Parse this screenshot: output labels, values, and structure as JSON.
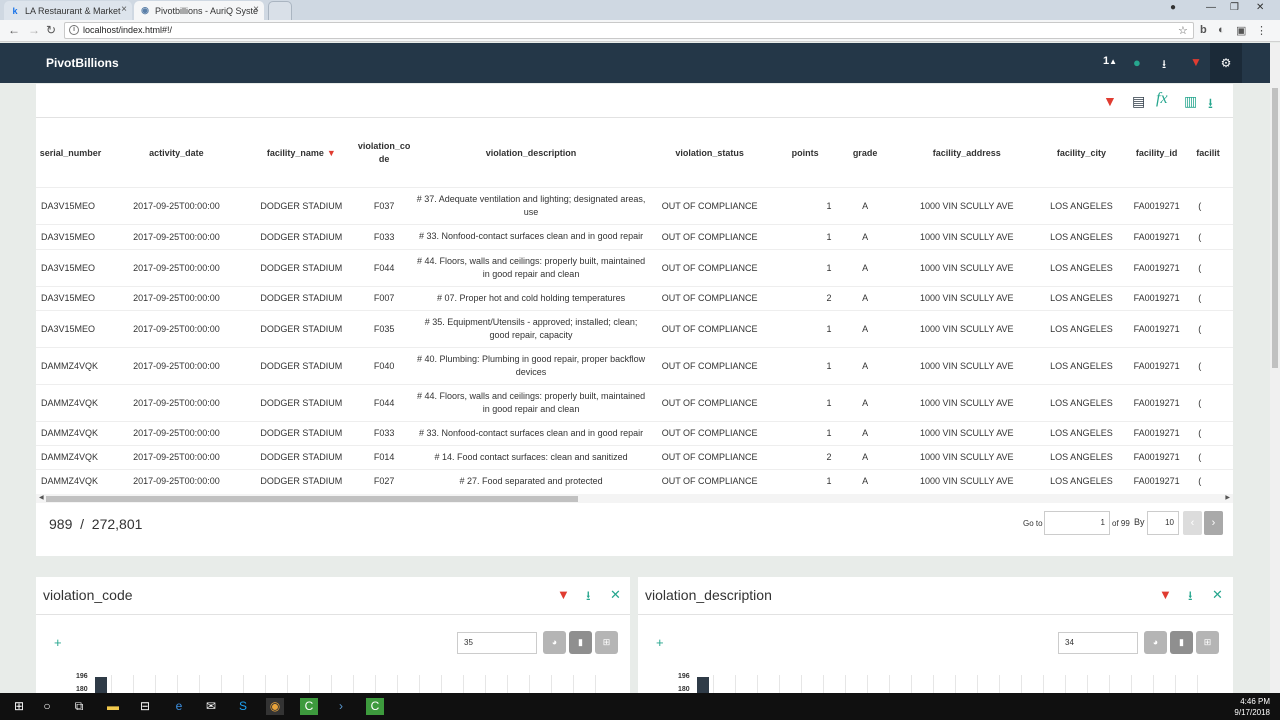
{
  "browser": {
    "tabs": [
      {
        "label": "LA Restaurant & Market",
        "favicon": "k"
      },
      {
        "label": "Pivotbillions - AuriQ Syste",
        "favicon": "globe"
      }
    ],
    "url": "localhost/index.html#!/"
  },
  "app": {
    "brand": "PivotBillions",
    "header_user_count": "1"
  },
  "table": {
    "columns": [
      "serial_number",
      "activity_date",
      "facility_name",
      "violation_code",
      "violation_description",
      "violation_status",
      "points",
      "grade",
      "facility_address",
      "facility_city",
      "facility_id",
      "facilit"
    ],
    "rows": [
      [
        "DA3V15MEO",
        "2017-09-25T00:00:00",
        "DODGER STADIUM",
        "F037",
        "# 37. Adequate ventilation and lighting; designated areas, use",
        "OUT OF COMPLIANCE",
        "1",
        "A",
        "1000 VIN SCULLY AVE",
        "LOS ANGELES",
        "FA0019271",
        "("
      ],
      [
        "DA3V15MEO",
        "2017-09-25T00:00:00",
        "DODGER STADIUM",
        "F033",
        "# 33. Nonfood-contact surfaces clean and in good repair",
        "OUT OF COMPLIANCE",
        "1",
        "A",
        "1000 VIN SCULLY AVE",
        "LOS ANGELES",
        "FA0019271",
        "("
      ],
      [
        "DA3V15MEO",
        "2017-09-25T00:00:00",
        "DODGER STADIUM",
        "F044",
        "# 44. Floors, walls and ceilings: properly built, maintained in good repair and clean",
        "OUT OF COMPLIANCE",
        "1",
        "A",
        "1000 VIN SCULLY AVE",
        "LOS ANGELES",
        "FA0019271",
        "("
      ],
      [
        "DA3V15MEO",
        "2017-09-25T00:00:00",
        "DODGER STADIUM",
        "F007",
        "# 07. Proper hot and cold holding temperatures",
        "OUT OF COMPLIANCE",
        "2",
        "A",
        "1000 VIN SCULLY AVE",
        "LOS ANGELES",
        "FA0019271",
        "("
      ],
      [
        "DA3V15MEO",
        "2017-09-25T00:00:00",
        "DODGER STADIUM",
        "F035",
        "# 35. Equipment/Utensils - approved; installed; clean; good repair, capacity",
        "OUT OF COMPLIANCE",
        "1",
        "A",
        "1000 VIN SCULLY AVE",
        "LOS ANGELES",
        "FA0019271",
        "("
      ],
      [
        "DAMMZ4VQK",
        "2017-09-25T00:00:00",
        "DODGER STADIUM",
        "F040",
        "# 40. Plumbing: Plumbing in good repair, proper backflow devices",
        "OUT OF COMPLIANCE",
        "1",
        "A",
        "1000 VIN SCULLY AVE",
        "LOS ANGELES",
        "FA0019271",
        "("
      ],
      [
        "DAMMZ4VQK",
        "2017-09-25T00:00:00",
        "DODGER STADIUM",
        "F044",
        "# 44. Floors, walls and ceilings: properly built, maintained in good repair and clean",
        "OUT OF COMPLIANCE",
        "1",
        "A",
        "1000 VIN SCULLY AVE",
        "LOS ANGELES",
        "FA0019271",
        "("
      ],
      [
        "DAMMZ4VQK",
        "2017-09-25T00:00:00",
        "DODGER STADIUM",
        "F033",
        "# 33. Nonfood-contact surfaces clean and in good repair",
        "OUT OF COMPLIANCE",
        "1",
        "A",
        "1000 VIN SCULLY AVE",
        "LOS ANGELES",
        "FA0019271",
        "("
      ],
      [
        "DAMMZ4VQK",
        "2017-09-25T00:00:00",
        "DODGER STADIUM",
        "F014",
        "# 14. Food contact surfaces: clean and sanitized",
        "OUT OF COMPLIANCE",
        "2",
        "A",
        "1000 VIN SCULLY AVE",
        "LOS ANGELES",
        "FA0019271",
        "("
      ],
      [
        "DAMMZ4VQK",
        "2017-09-25T00:00:00",
        "DODGER STADIUM",
        "F027",
        "# 27. Food separated and protected",
        "OUT OF COMPLIANCE",
        "1",
        "A",
        "1000 VIN SCULLY AVE",
        "LOS ANGELES",
        "FA0019271",
        "("
      ]
    ],
    "filtered_column": "facility_name"
  },
  "footer": {
    "count": "989  /  272,801",
    "goto_label": "Go to",
    "page_value": "1",
    "of_pages": "of 99",
    "by_label": "By",
    "by_value": "10"
  },
  "panels": [
    {
      "title": "violation_code",
      "input_value": "35",
      "ytick_top": "196",
      "ytick_next": "180"
    },
    {
      "title": "violation_description",
      "input_value": "34",
      "ytick_top": "196",
      "ytick_next": "180"
    }
  ],
  "taskbar": {
    "time": "4:46 PM",
    "date": "9/17/2018"
  },
  "colors": {
    "header_bg": "#243748",
    "filter_red": "#e03c31",
    "accent_green": "#26a68e"
  }
}
